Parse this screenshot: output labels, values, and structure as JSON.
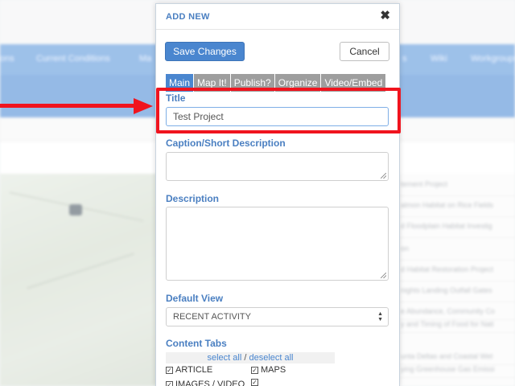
{
  "background": {
    "nav_items": [
      "ons",
      "Current Conditions",
      "Ma",
      "s",
      "Wiki",
      "Workgroups"
    ],
    "list_rows": [
      "tement Project",
      "almon Habitat on Rice Fields",
      "d Floodplain Habitat Investig",
      "on",
      "d Habitat Restoration Project",
      "nights Landing Outfall Gates",
      "e Abundance, Community Co",
      "y and Timing of Food for Nati",
      "unta Deltas and Coastal Wet",
      "ying Greenhouse Gas Emissi"
    ]
  },
  "modal": {
    "title": "ADD NEW",
    "close_glyph": "✖",
    "save_label": "Save Changes",
    "cancel_label": "Cancel",
    "tabs": [
      "Main",
      "Map It!",
      "Publish?",
      "Organize",
      "Video/Embed"
    ],
    "active_tab": "Main",
    "title_field": {
      "label": "Title",
      "value": "Test Project"
    },
    "caption_field": {
      "label": "Caption/Short Description",
      "value": ""
    },
    "description_field": {
      "label": "Description",
      "value": ""
    },
    "default_view": {
      "label": "Default View",
      "selected": "RECENT ACTIVITY"
    },
    "content_tabs": {
      "label": "Content Tabs",
      "select_all": "select all",
      "separator": "/",
      "deselect_all": "deselect all",
      "items": [
        {
          "label": "ARTICLE",
          "checked": true
        },
        {
          "label": "MAPS",
          "checked": true
        },
        {
          "label": "IMAGES / VIDEO",
          "checked": true
        },
        {
          "label": "",
          "checked": true
        }
      ]
    }
  },
  "annotation": {
    "color": "#f0141e",
    "target": "title-field"
  },
  "colors": {
    "accent": "#4a86cf",
    "label_blue": "#4a7fc1",
    "tab_inactive": "#9e9e9e"
  }
}
